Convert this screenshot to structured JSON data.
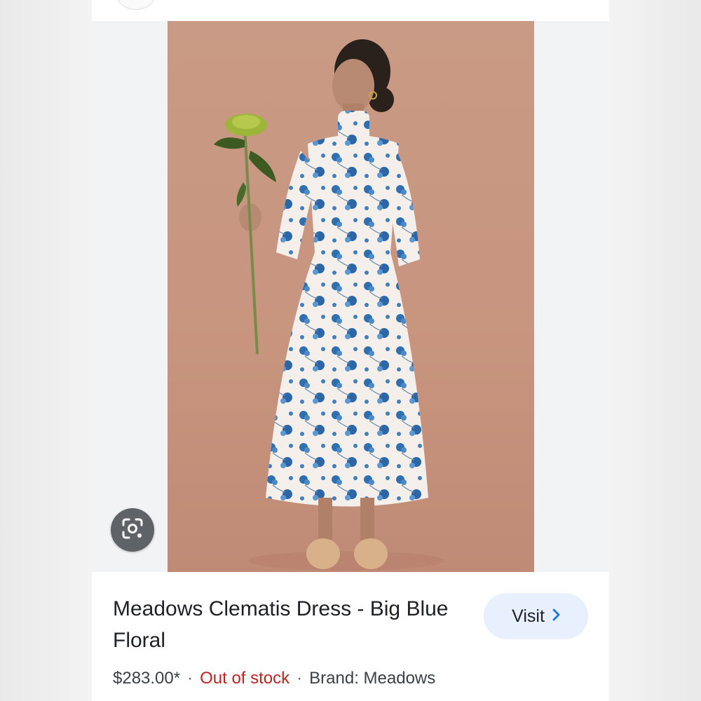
{
  "product": {
    "title": "Meadows Clematis Dress - Big Blue Floral",
    "price": "$283.00*",
    "stock_status": "Out of stock",
    "brand": "Brand: Meadows",
    "image_description": "Model in blue floral print high-neck midi dress holding a green chrysanthemum"
  },
  "actions": {
    "visit_label": "Visit",
    "lens_icon": "google-lens-icon",
    "chevron_icon": "chevron-right-icon"
  },
  "colors": {
    "accent": "#1a73e8",
    "visit_bg": "#e8f0fe",
    "stock_red": "#c5221f",
    "photo_bg": "#c99a85"
  }
}
